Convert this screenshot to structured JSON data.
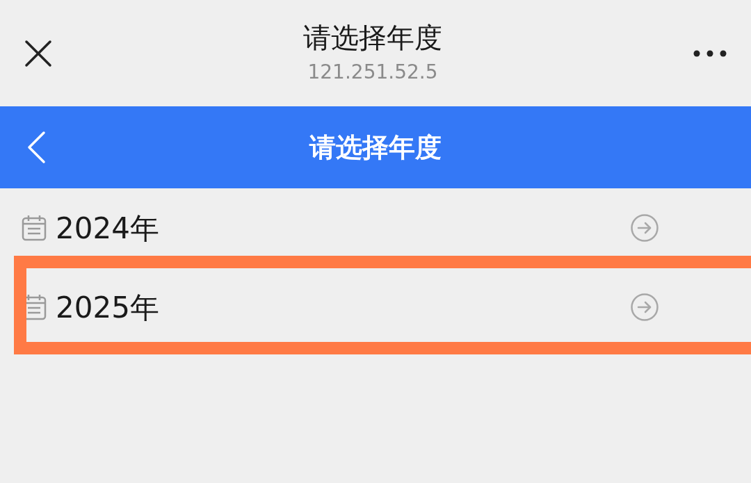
{
  "nav": {
    "title": "请选择年度",
    "subtitle": "121.251.52.5"
  },
  "header": {
    "title": "请选择年度"
  },
  "years": [
    {
      "label": "2024年",
      "highlighted": false
    },
    {
      "label": "2025年",
      "highlighted": true
    }
  ]
}
